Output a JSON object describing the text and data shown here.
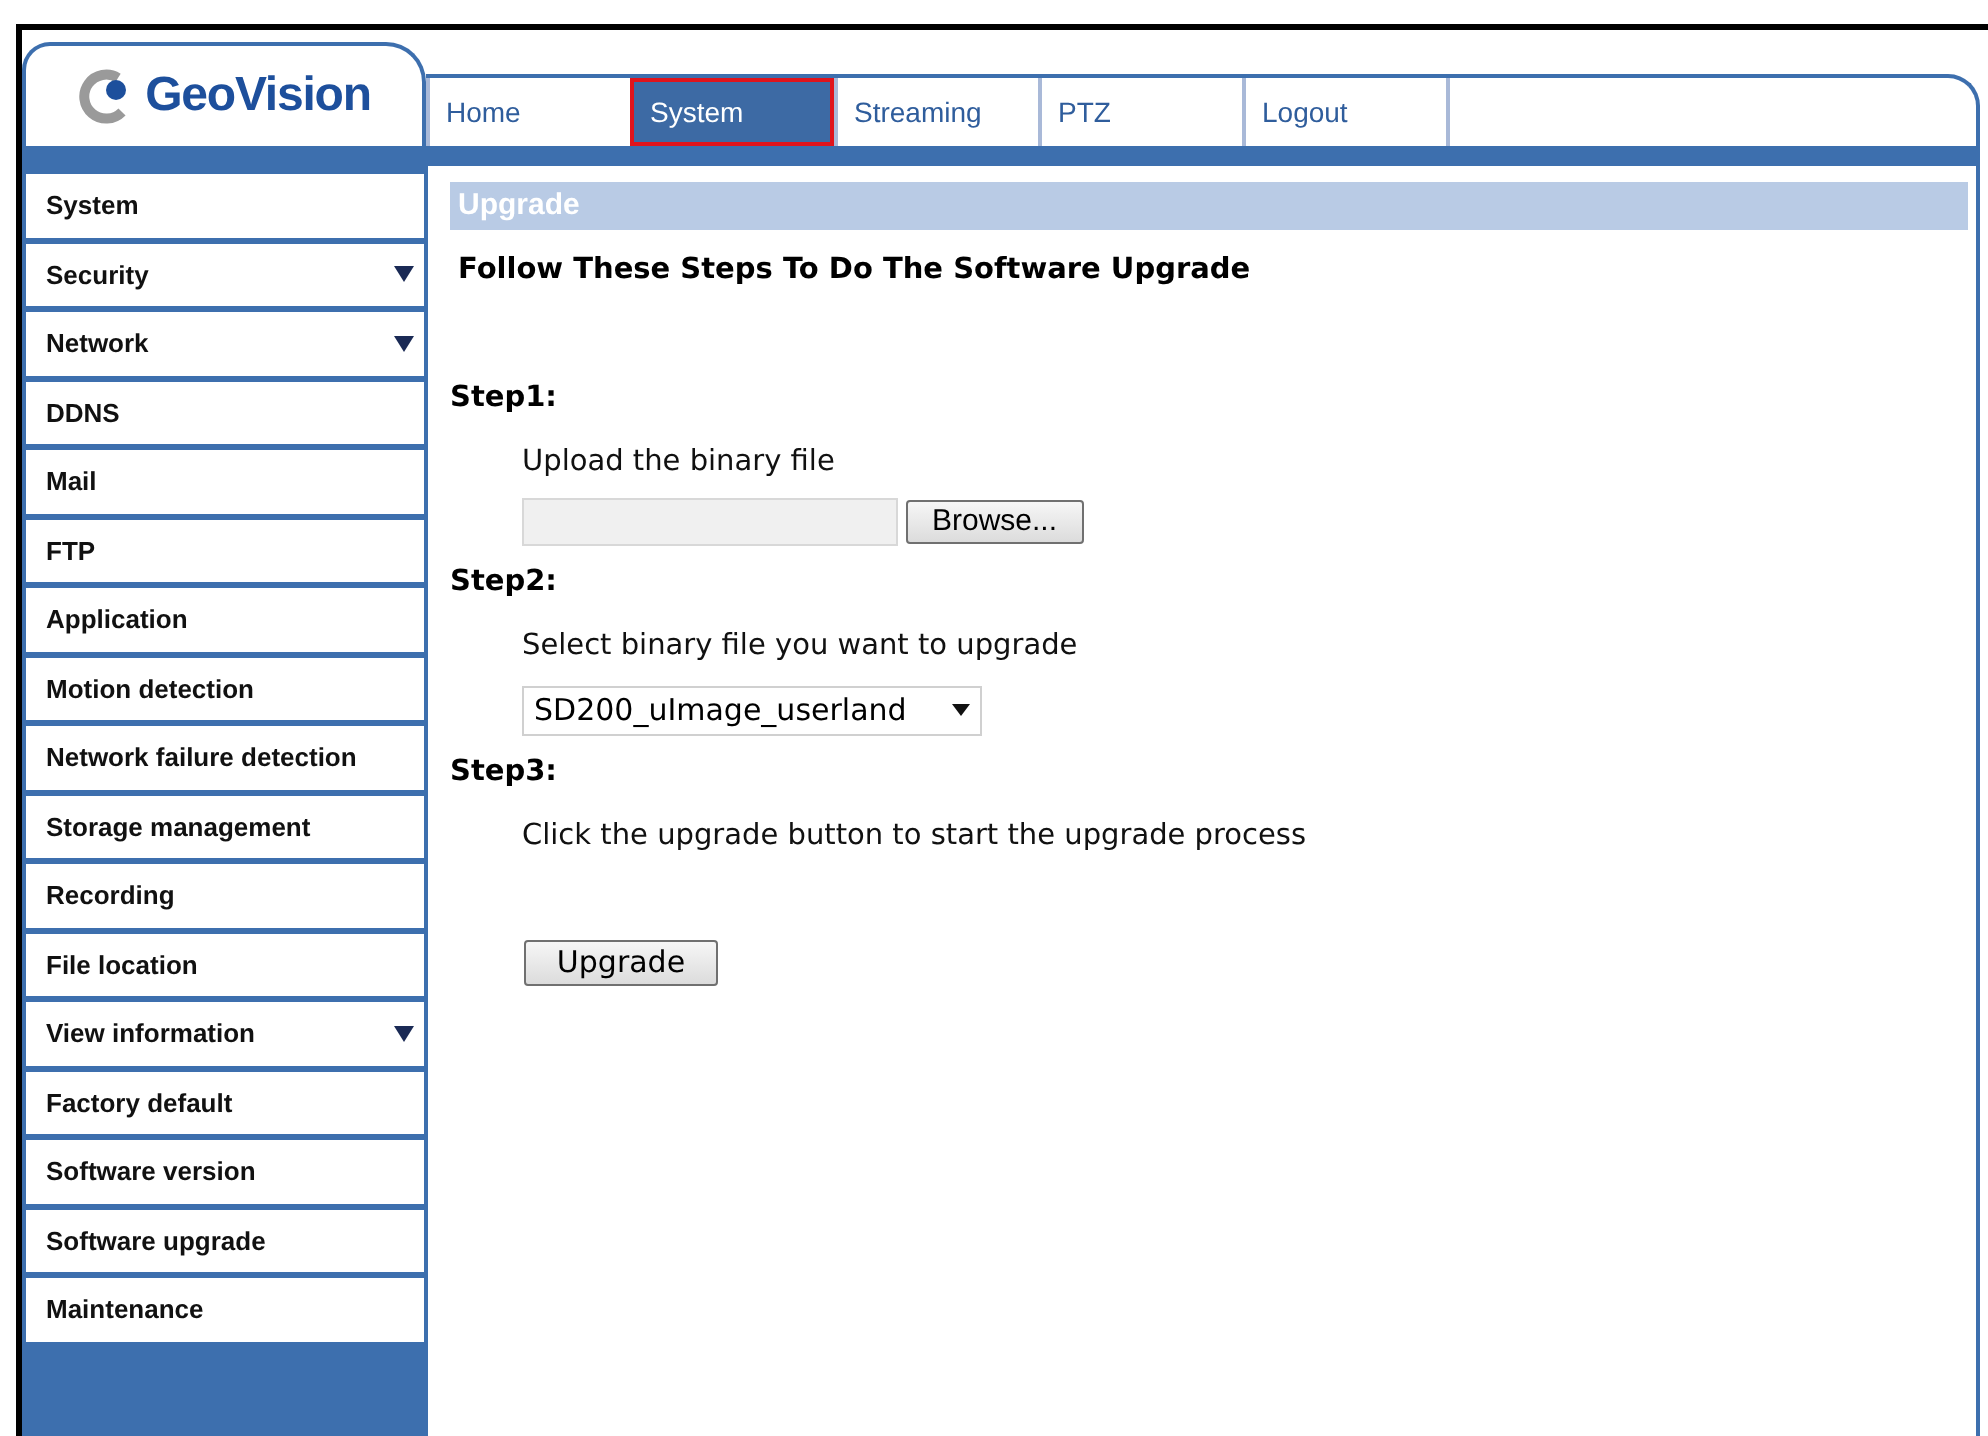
{
  "logo": {
    "text": "GeoVision"
  },
  "tabs": [
    {
      "label": "Home",
      "selected": false
    },
    {
      "label": "System",
      "selected": true
    },
    {
      "label": "Streaming",
      "selected": false
    },
    {
      "label": "PTZ",
      "selected": false
    },
    {
      "label": "Logout",
      "selected": false
    }
  ],
  "sidebar": {
    "items": [
      {
        "label": "System",
        "has_submenu": false
      },
      {
        "label": "Security",
        "has_submenu": true
      },
      {
        "label": "Network",
        "has_submenu": true
      },
      {
        "label": "DDNS",
        "has_submenu": false
      },
      {
        "label": "Mail",
        "has_submenu": false
      },
      {
        "label": "FTP",
        "has_submenu": false
      },
      {
        "label": "Application",
        "has_submenu": false
      },
      {
        "label": "Motion detection",
        "has_submenu": false
      },
      {
        "label": "Network failure detection",
        "has_submenu": false
      },
      {
        "label": "Storage management",
        "has_submenu": false
      },
      {
        "label": "Recording",
        "has_submenu": false
      },
      {
        "label": "File location",
        "has_submenu": false
      },
      {
        "label": "View information",
        "has_submenu": true
      },
      {
        "label": "Factory default",
        "has_submenu": false
      },
      {
        "label": "Software version",
        "has_submenu": false
      },
      {
        "label": "Software upgrade",
        "has_submenu": false
      },
      {
        "label": "Maintenance",
        "has_submenu": false
      }
    ]
  },
  "content": {
    "section_title": "Upgrade",
    "heading": "Follow These Steps To Do The Software Upgrade",
    "steps": [
      {
        "title": "Step1:",
        "instruction": "Upload the binary file",
        "kind": "file",
        "button": "Browse..."
      },
      {
        "title": "Step2:",
        "instruction": "Select binary file you want to upgrade",
        "kind": "select",
        "value": "SD200_uImage_userland"
      },
      {
        "title": "Step3:",
        "instruction": "Click the upgrade button to start the upgrade process",
        "kind": "button",
        "button": "Upgrade"
      }
    ]
  }
}
